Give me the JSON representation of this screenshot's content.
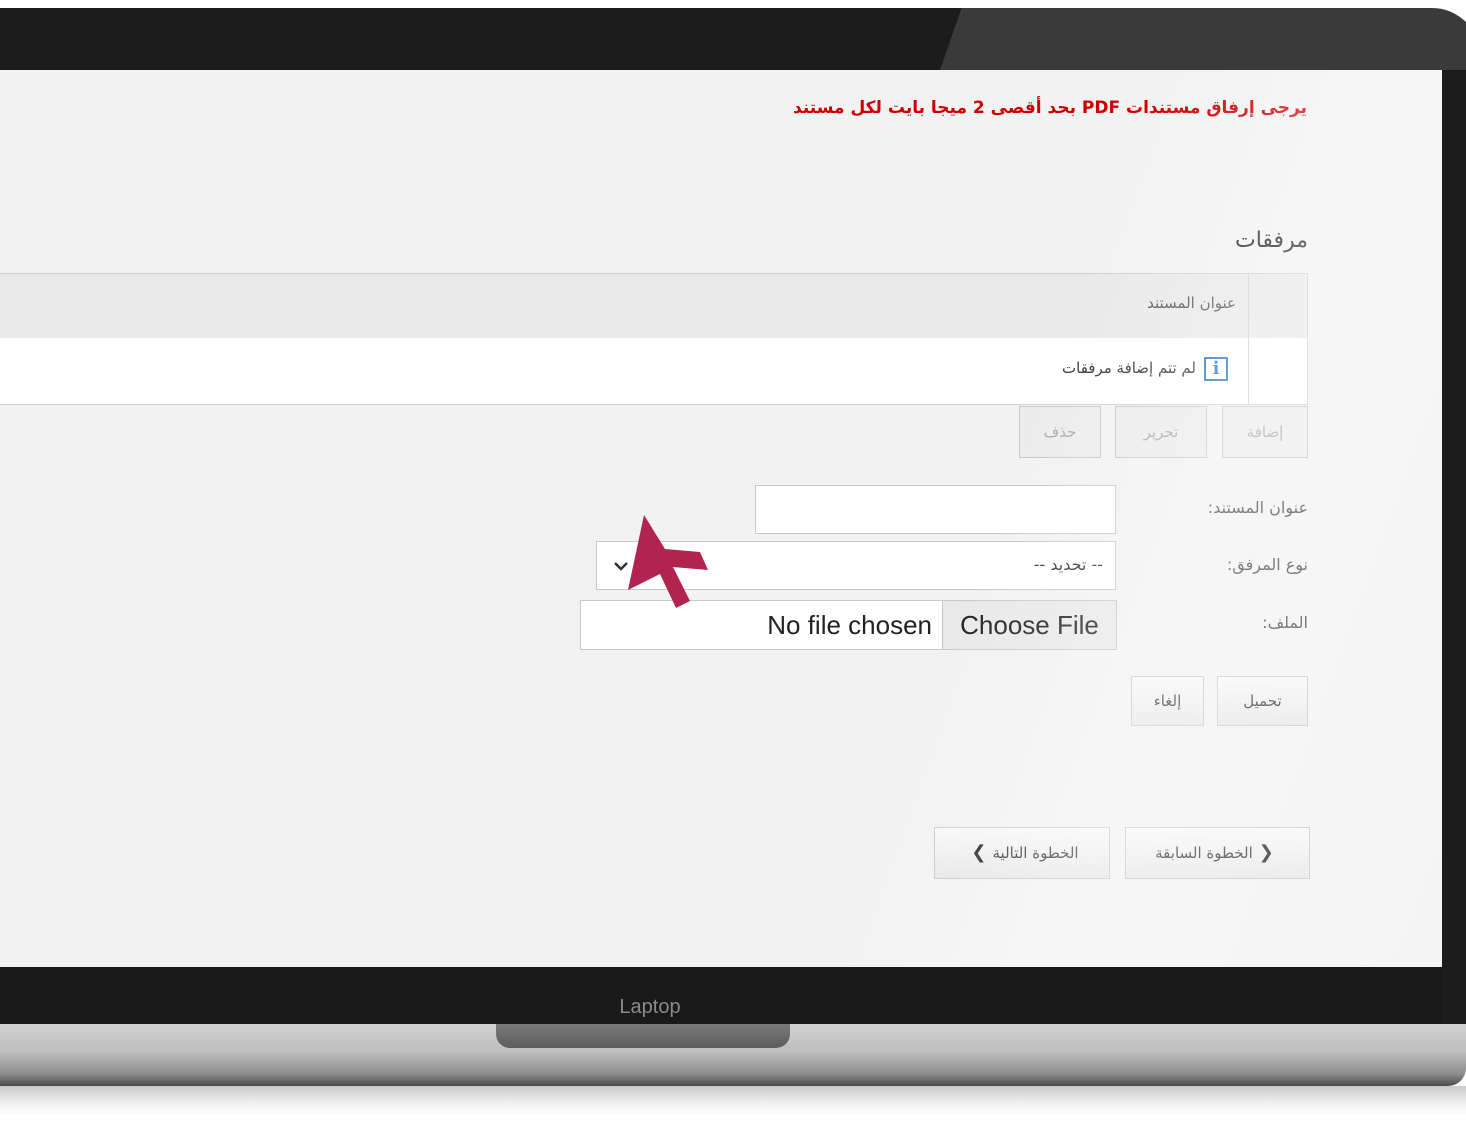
{
  "device": {
    "label": "Laptop"
  },
  "page": {
    "notice": "يرجى إرفاق مستندات PDF بحد أقصى 2 ميجا بايت لكل مستند",
    "section_title": "مرفقات",
    "grid": {
      "column_title": "عنوان المستند",
      "empty_message": "لم تتم إضافة مرفقات",
      "info_icon": "i"
    },
    "grid_actions": {
      "add": "إضافة",
      "edit": "تحرير",
      "delete": "حذف"
    },
    "form": {
      "doc_title_label": "عنوان المستند:",
      "doc_title_value": "",
      "attachment_type_label": "نوع المرفق:",
      "attachment_type_selected": "-- تحديد --",
      "file_label": "الملف:",
      "choose_file": "Choose File",
      "no_file": "No file chosen",
      "upload": "تحميل",
      "cancel": "إلغاء"
    },
    "nav": {
      "previous": "الخطوة السابقة",
      "next": "الخطوة التالية"
    }
  },
  "colors": {
    "notice": "#cc0000",
    "info_icon": "#2a7bc2",
    "cursor_arrow": "#b0244f"
  }
}
